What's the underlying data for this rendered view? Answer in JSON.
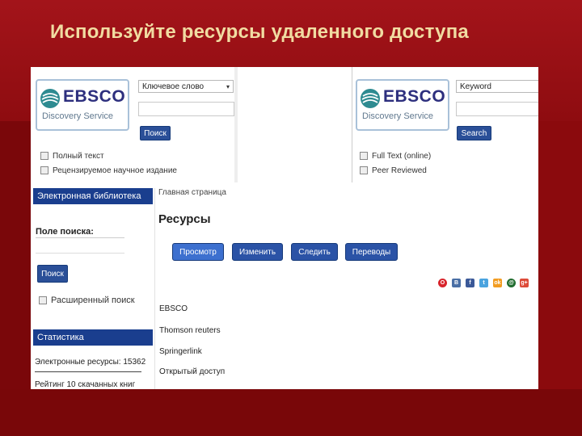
{
  "slide": {
    "title": "Используйте ресурсы удаленного доступа"
  },
  "ebsco_ru": {
    "logo_brand": "EBSCO",
    "logo_sub": "Discovery Service",
    "select_value": "Ключевое слово",
    "search_button": "Поиск",
    "checkbox_fulltext": "Полный текст",
    "checkbox_peer": "Рецензируемое научное издание"
  },
  "ebsco_en": {
    "logo_brand": "EBSCO",
    "logo_sub": "Discovery Service",
    "select_value": "Keyword",
    "search_button": "Search",
    "checkbox_fulltext": "Full Text (online)",
    "checkbox_peer": "Peer Reviewed"
  },
  "library": {
    "header": "Электронная библиотека",
    "search_label": "Поле поиска:",
    "search_button": "Поиск",
    "advanced_search": "Расширенный поиск"
  },
  "stats": {
    "header": "Статистика",
    "resources": "Электронные ресурсы: 15362",
    "rating": "Рейтинг 10 скачанных книг"
  },
  "main": {
    "breadcrumb": "Главная страница",
    "heading": "Ресурсы",
    "tabs": [
      "Просмотр",
      "Изменить",
      "Следить",
      "Переводы"
    ],
    "social_icons": [
      "opera-icon",
      "vkontakte-icon",
      "facebook-icon",
      "twitter-icon",
      "odnoklassniki-icon",
      "mailru-icon",
      "googleplus-icon"
    ],
    "resources": [
      "EBSCO",
      "Thomson reuters",
      "Springerlink",
      "Открытый доступ"
    ]
  }
}
